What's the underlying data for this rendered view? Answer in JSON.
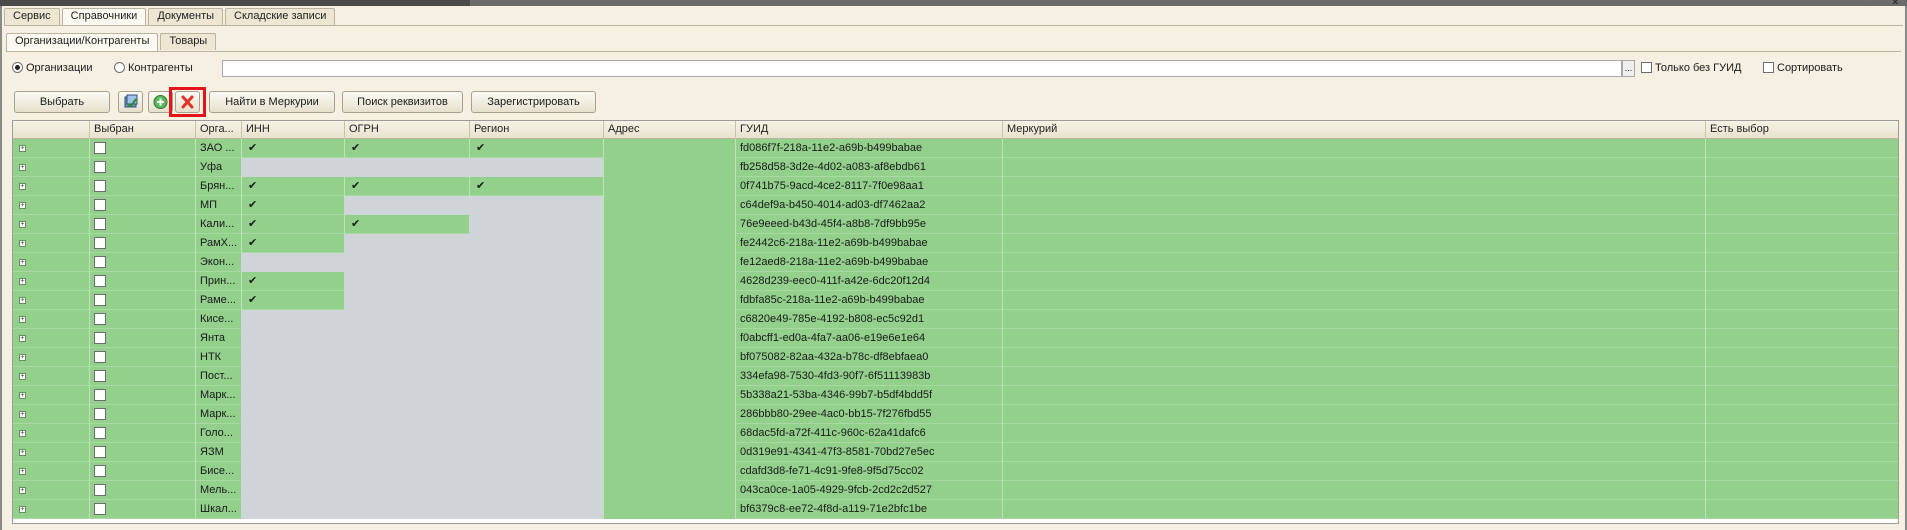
{
  "tabs_main": [
    "Сервис",
    "Справочники",
    "Документы",
    "Складские записи"
  ],
  "tabs_main_active": 1,
  "tabs_sub": [
    "Организации/Контрагенты",
    "Товары"
  ],
  "tabs_sub_active": 0,
  "filters": {
    "radio_org": "Организации",
    "radio_contr": "Контрагенты",
    "search_value": "",
    "search_button": "...",
    "only_without_guid": "Только без ГУИД",
    "sort": "Сортировать"
  },
  "toolbar": {
    "select": "Выбрать",
    "find_mercury": "Найти в Меркурии",
    "search_requisites": "Поиск реквизитов",
    "register": "Зарегистрировать",
    "delete_icon_color": "#e4141b",
    "add_icon_color": "#4caf50"
  },
  "columns": [
    "Выбран",
    "Орга...",
    "ИНН",
    "ОГРН",
    "Регион",
    "Адрес",
    "ГУИД",
    "Меркурий",
    "Есть выбор"
  ],
  "colors": {
    "row_green": "#92d08c",
    "cell_gray": "#cfd4d9",
    "highlight": "#e4141b"
  },
  "tick_glyph": "✔",
  "expander_glyph": "+",
  "rows": [
    {
      "org": "ЗАО ...",
      "inn": true,
      "ogrn": true,
      "region": true,
      "guid": "fd086f7f-218a-11e2-a69b-b499babae"
    },
    {
      "org": "Уфа",
      "inn": null,
      "ogrn": null,
      "region": null,
      "guid": "fb258d58-3d2e-4d02-a083-af8ebdb61"
    },
    {
      "org": "Брян...",
      "inn": true,
      "ogrn": true,
      "region": true,
      "guid": "0f741b75-9acd-4ce2-8117-7f0e98aa1"
    },
    {
      "org": "МП",
      "inn": true,
      "ogrn": null,
      "region": null,
      "guid": "c64def9a-b450-4014-ad03-df7462aa2"
    },
    {
      "org": "Кали...",
      "inn": true,
      "ogrn": true,
      "region": null,
      "guid": "76e9eeed-b43d-45f4-a8b8-7df9bb95e"
    },
    {
      "org": "РамХ...",
      "inn": true,
      "ogrn": null,
      "region": null,
      "guid": "fe2442c6-218a-11e2-a69b-b499babae"
    },
    {
      "org": "Экон...",
      "inn": null,
      "ogrn": null,
      "region": null,
      "guid": "fe12aed8-218a-11e2-a69b-b499babae"
    },
    {
      "org": "Прин...",
      "inn": true,
      "ogrn": null,
      "region": null,
      "guid": "4628d239-eec0-411f-a42e-6dc20f12d4"
    },
    {
      "org": "Раме...",
      "inn": true,
      "ogrn": null,
      "region": null,
      "guid": "fdbfa85c-218a-11e2-a69b-b499babae"
    },
    {
      "org": "Кисе...",
      "inn": null,
      "ogrn": null,
      "region": null,
      "guid": "c6820e49-785e-4192-b808-ec5c92d1"
    },
    {
      "org": "Янта",
      "inn": null,
      "ogrn": null,
      "region": null,
      "guid": "f0abcff1-ed0a-4fa7-aa06-e19e6e1e64"
    },
    {
      "org": "НТК",
      "inn": null,
      "ogrn": null,
      "region": null,
      "guid": "bf075082-82aa-432a-b78c-df8ebfaea0"
    },
    {
      "org": "Пост...",
      "inn": null,
      "ogrn": null,
      "region": null,
      "guid": "334efa98-7530-4fd3-90f7-6f51113983b"
    },
    {
      "org": "Марк...",
      "inn": null,
      "ogrn": null,
      "region": null,
      "guid": "5b338a21-53ba-4346-99b7-b5df4bdd5f"
    },
    {
      "org": "Марк...",
      "inn": null,
      "ogrn": null,
      "region": null,
      "guid": "286bbb80-29ee-4ac0-bb15-7f276fbd55"
    },
    {
      "org": "Голо...",
      "inn": null,
      "ogrn": null,
      "region": null,
      "guid": "68dac5fd-a72f-411c-960c-62a41dafc6"
    },
    {
      "org": "ЯЗМ",
      "inn": null,
      "ogrn": null,
      "region": null,
      "guid": "0d319e91-4341-47f3-8581-70bd27e5ec"
    },
    {
      "org": "Бисе...",
      "inn": null,
      "ogrn": null,
      "region": null,
      "guid": "cdafd3d8-fe71-4c91-9fe8-9f5d75cc02"
    },
    {
      "org": "Мель...",
      "inn": null,
      "ogrn": null,
      "region": null,
      "guid": "043ca0ce-1a05-4929-9fcb-2cd2c2d527"
    },
    {
      "org": "Шкал...",
      "inn": null,
      "ogrn": null,
      "region": null,
      "guid": "bf6379c8-ee72-4f8d-a119-71e2bfc1be"
    }
  ]
}
